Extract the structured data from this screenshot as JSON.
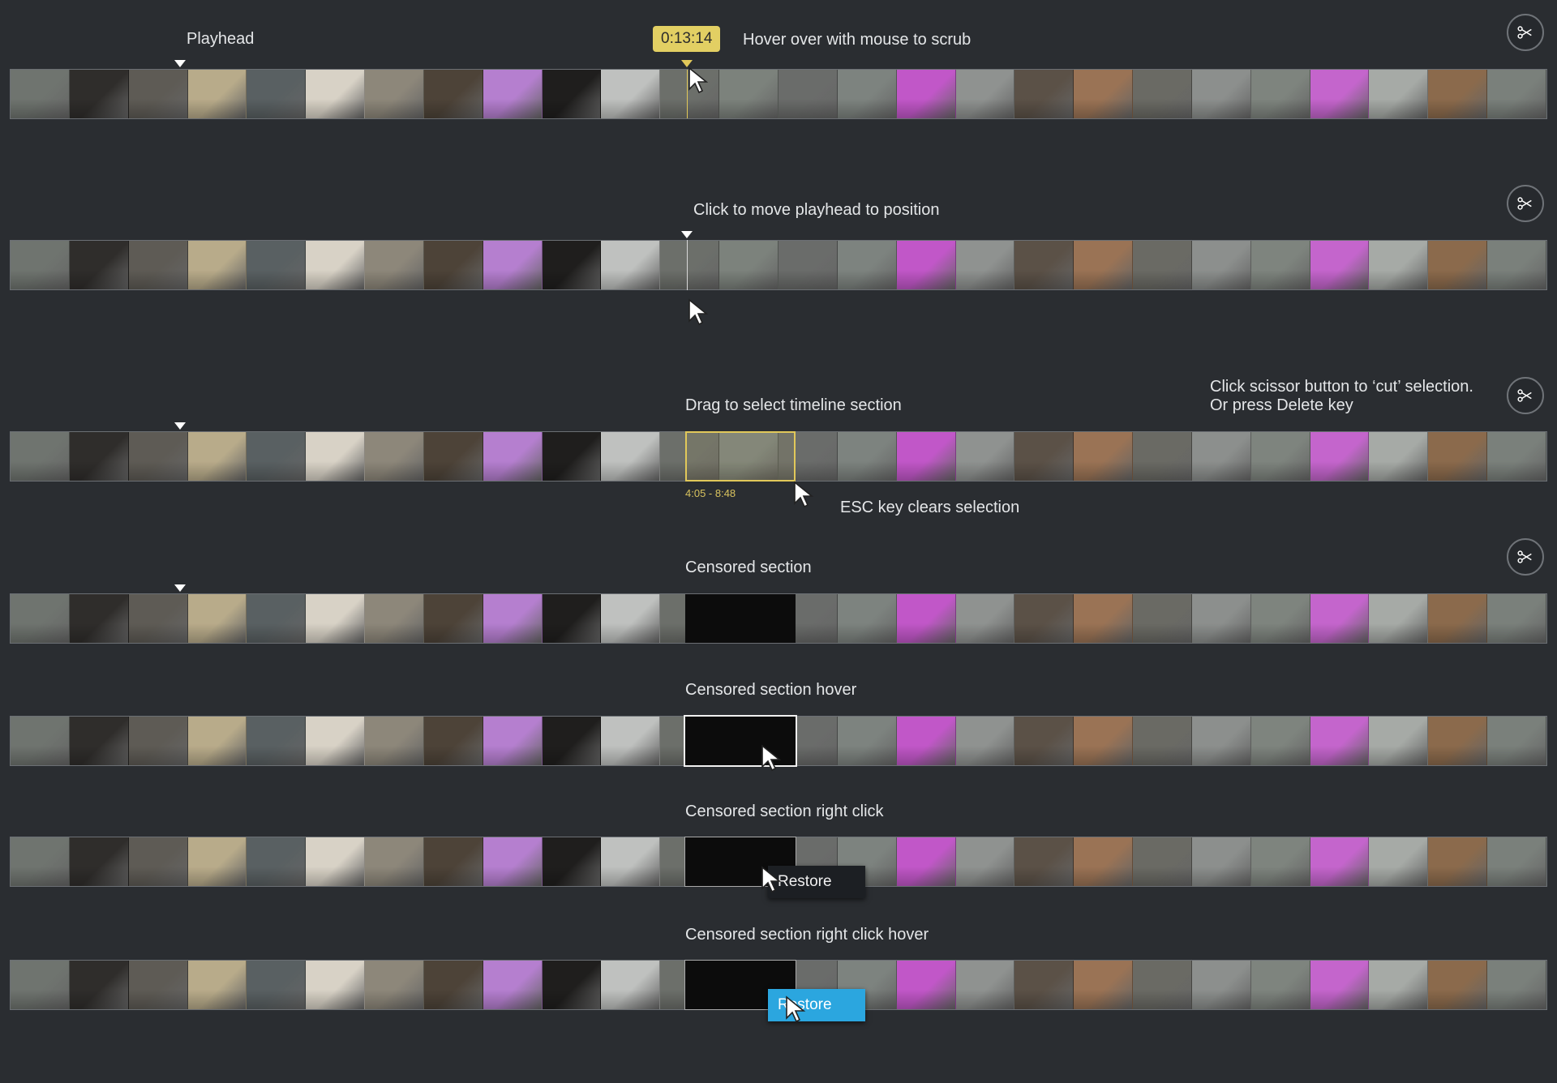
{
  "frame_colors": [
    "#6f746f",
    "#2f2d2b",
    "#5e5b55",
    "#b8ab8a",
    "#596062",
    "#d8d2c6",
    "#8d877a",
    "#4d4338",
    "#b57fcf",
    "#1f1e1d",
    "#bfc1bf",
    "#6c6f6a",
    "#7c827c",
    "#6a6c6a",
    "#7d837f",
    "#c157c8",
    "#8f9290",
    "#5b5147",
    "#9a7355",
    "#6a6a64",
    "#8c8f8d",
    "#7e847e",
    "#c465cc",
    "#a6aaa6",
    "#8b6a4c",
    "#7a807b"
  ],
  "tooltip_time": "0:13:14",
  "labels": {
    "playhead": "Playhead",
    "hover_scrub": "Hover over with mouse to scrub",
    "click_move": "Click to move playhead to position",
    "drag_select": "Drag to select timeline section",
    "scissor_hint_1": "Click scissor button to ‘cut’ selection.",
    "scissor_hint_2": "Or press Delete key",
    "esc_clear": "ESC key clears selection",
    "censored": "Censored section",
    "censored_hover": "Censored section hover",
    "censored_right_click": "Censored section right click",
    "censored_right_click_hover": "Censored section right click hover"
  },
  "selection_range": "4:05 - 8:48",
  "context_menu": {
    "restore_label": "Restore"
  },
  "icons": {
    "scissor": "scissor-icon",
    "cursor": "mouse-pointer-icon",
    "playhead": "playhead-triangle-icon"
  },
  "accent_colors": {
    "selection": "#e1c85a",
    "menu_hover": "#2ba6df",
    "censored": "#0c0c0c"
  }
}
